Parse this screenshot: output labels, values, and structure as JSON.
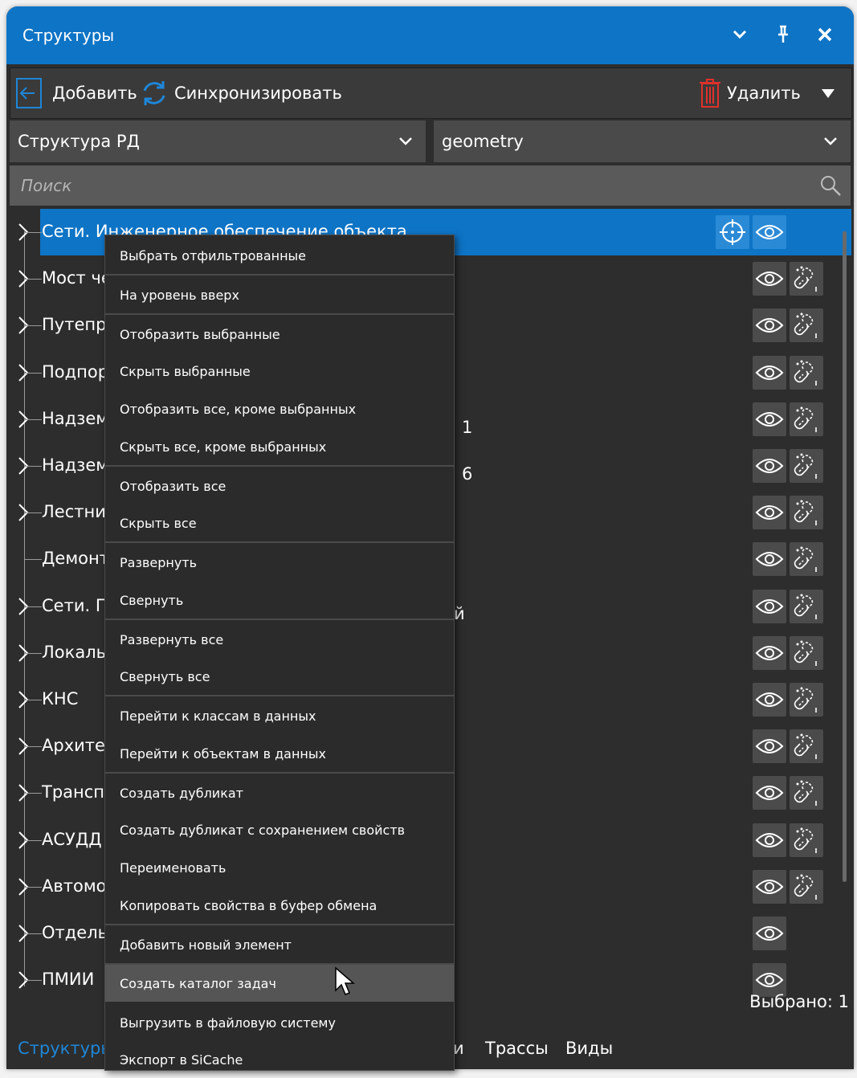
{
  "window": {
    "title": "Структуры"
  },
  "toolbar": {
    "add": "Добавить",
    "sync": "Синхронизировать",
    "delete": "Удалить"
  },
  "selectors": {
    "structure": "Структура РД",
    "geometry": "geometry"
  },
  "search": {
    "placeholder": "Поиск"
  },
  "tree": {
    "rows": [
      {
        "label": "Сети. Инженерное обеспечение объекта"
      },
      {
        "label": "Мост че"
      },
      {
        "label": "Путепро"
      },
      {
        "label": "Подпор"
      },
      {
        "label": "Надзем",
        "suffix": "1"
      },
      {
        "label": "Надзем",
        "suffix": "6"
      },
      {
        "label": "Лестни"
      },
      {
        "label": "Демонт"
      },
      {
        "label": "Сети. П",
        "suffix": "й"
      },
      {
        "label": "Локаль"
      },
      {
        "label": "КНС"
      },
      {
        "label": "Архите"
      },
      {
        "label": "Трансп"
      },
      {
        "label": "АСУДД"
      },
      {
        "label": "Автомо"
      },
      {
        "label": "Отдель"
      },
      {
        "label": "ПМИИ"
      }
    ]
  },
  "context_menu": {
    "items": [
      "Выбрать отфильтрованные",
      "На уровень вверх",
      "Отобразить выбранные",
      "Скрыть выбранные",
      "Отобразить все, кроме выбранных",
      "Скрыть все, кроме выбранных",
      "Отобразить все",
      "Скрыть все",
      "Развернуть",
      "Свернуть",
      "Развернуть все",
      "Свернуть все",
      "Перейти к классам в данных",
      "Перейти к объектам в данных",
      "Создать дубликат",
      "Создать дубликат с сохранением свойств",
      "Переименовать",
      "Копировать свойства в буфер обмена",
      "Добавить новый элемент",
      "Создать каталог задач",
      "Выгрузить в файловую систему",
      "Экспорт в SiCache"
    ],
    "hovered": "Создать каталог задач"
  },
  "status": {
    "selected": "Выбрано: 1"
  },
  "bottom_tabs": {
    "structures": "Структуры",
    "partial": "и",
    "routes": "Трассы",
    "views": "Виды"
  },
  "colors": {
    "accent": "#0e74c6",
    "background": "#2d2d2d",
    "delete_icon": "#e0312a"
  }
}
